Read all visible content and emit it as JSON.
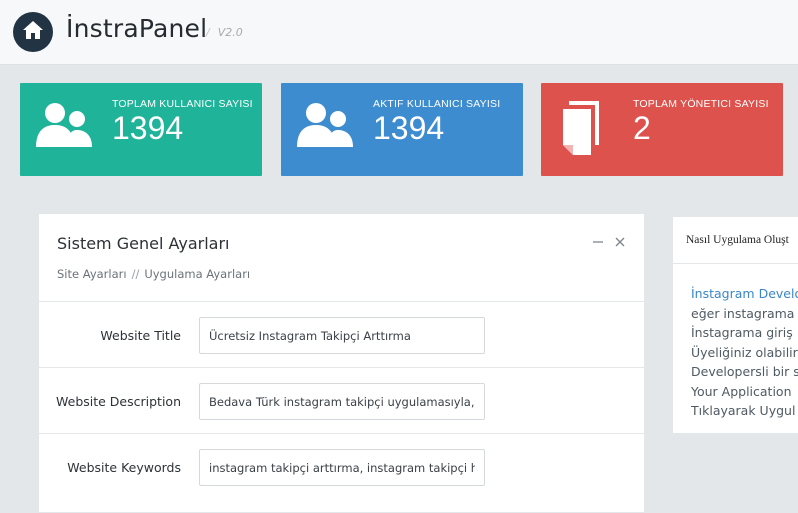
{
  "header": {
    "brand": "İnstraPanel",
    "version": "V2.0",
    "separator": "/"
  },
  "stats": [
    {
      "label": "TOPLAM KULLANICI SAYISI",
      "value": "1394",
      "icon": "users-icon",
      "color": "#1fb499"
    },
    {
      "label": "AKTIF KULLANICI SAYISI",
      "value": "1394",
      "icon": "users-icon",
      "color": "#3e8cd0"
    },
    {
      "label": "TOPLAM YÖNETICI SAYISI",
      "value": "2",
      "icon": "documents-icon",
      "color": "#de524d"
    }
  ],
  "panel": {
    "title": "Sistem Genel Ayarları",
    "breadcrumb": [
      "Site Ayarları",
      "Uygulama Ayarları"
    ],
    "breadcrumb_sep": "//",
    "fields": [
      {
        "label": "Website Title",
        "value": "Ücretsiz Instagram Takipçi Arttırma"
      },
      {
        "label": "Website Description",
        "value": "Bedava Türk instagram takipçi uygulamasıyla, siz de takipçi kazanın"
      },
      {
        "label": "Website Keywords",
        "value": "instagram takipçi arttırma, instagram takipçi hilesi"
      }
    ]
  },
  "info": {
    "title": "Nasıl Uygulama Oluşt",
    "lines": [
      {
        "text": "İnstagram Develo",
        "link": true
      },
      {
        "text": "eğer instagrama",
        "link": false
      },
      {
        "text": "İnstagrama giriş",
        "link": false
      },
      {
        "text": "Üyeliğiniz olabilir",
        "link": false
      },
      {
        "text": "Developersli bir s",
        "link": false
      },
      {
        "text": "Your Application",
        "link": false
      },
      {
        "text": "Tıklayarak Uygul",
        "link": false
      }
    ]
  },
  "colors": {
    "header_bg": "#f7f8f9",
    "page_bg": "#e4e7ea",
    "home_button": "#223344",
    "link": "#3a86c8"
  }
}
